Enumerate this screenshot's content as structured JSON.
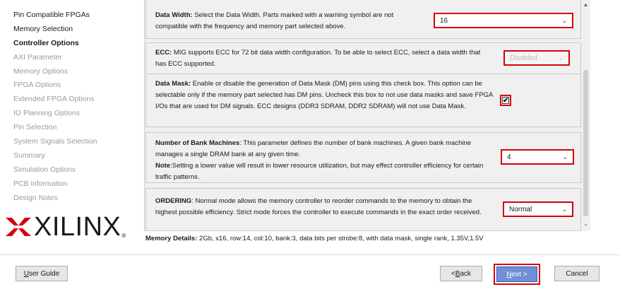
{
  "nav": {
    "items": [
      {
        "label": "Pin Compatible FPGAs",
        "state": "done"
      },
      {
        "label": "Memory Selection",
        "state": "done"
      },
      {
        "label": "Controller Options",
        "state": "active"
      },
      {
        "label": "AXI Parameter",
        "state": "pending"
      },
      {
        "label": "Memory Options",
        "state": "pending"
      },
      {
        "label": "FPGA Options",
        "state": "pending"
      },
      {
        "label": "Extended FPGA Options",
        "state": "pending"
      },
      {
        "label": "IO Planning Options",
        "state": "pending"
      },
      {
        "label": "Pin Selection",
        "state": "pending"
      },
      {
        "label": "System Signals Selection",
        "state": "pending"
      },
      {
        "label": "Summary",
        "state": "pending"
      },
      {
        "label": "Simulation Options",
        "state": "pending"
      },
      {
        "label": "PCB information",
        "state": "pending"
      },
      {
        "label": "Design Notes",
        "state": "pending"
      }
    ]
  },
  "logo": {
    "text": "XILINX",
    "reg": "®"
  },
  "sections": {
    "data_width": {
      "title": "Data Width:",
      "text": " Select the Data Width. Parts marked with a warning symbol are not compatible with the frequency and memory part selected above.",
      "value": "16"
    },
    "ecc": {
      "title": "ECC:",
      "text": " MIG supports ECC for 72 bit data width configuration. To be able to select ECC, select a data width that has ECC supported.",
      "value": "Disabled"
    },
    "data_mask": {
      "title": "Data Mask:",
      "text": " Enable or disable the generation of Data Mask (DM) pins using this check box. This option can be selectable only if the memory part selected has DM pins. Uncheck this box to not use data masks and save FPGA I/Os that are used for DM signals. ECC designs (DDR3 SDRAM, DDR2 SDRAM) will not use Data Mask.",
      "checked": true,
      "check_glyph": "✔"
    },
    "bank_machines": {
      "title": "Number of Bank Machines",
      "text": ": This parameter defines the number of bank machines. A given bank machine manages a single DRAM bank at any given time.",
      "note_title": "Note",
      "note_text": ":Setting a lower value will result in lower resource utilization, but may effect controller efficiency for certain traffic patterns.",
      "value": "4"
    },
    "ordering": {
      "title": "ORDERING",
      "text": ": Normal mode allows the memory controller to reorder commands to the memory to obtain the highest possible efficiency. Strict mode forces the controller to execute commands in the exact order received.",
      "value": "Normal"
    }
  },
  "chevron": "⌄",
  "scroll_up": "▲",
  "scroll_down": "⌄",
  "memory_details": {
    "label": "Memory Details:",
    "value": " 2Gb, x16, row:14, col:10, bank:3, data bits per strobe:8, with data mask, single rank, 1.35V,1.5V"
  },
  "buttons": {
    "user_guide_u": "U",
    "user_guide_rest": "ser Guide",
    "back_prefix": "< ",
    "back_u": "B",
    "back_rest": "ack",
    "next_u": "N",
    "next_rest": "ext >",
    "cancel": "Cancel"
  },
  "colors": {
    "highlight": "#d8000c",
    "next_button": "#6f8fd6"
  }
}
